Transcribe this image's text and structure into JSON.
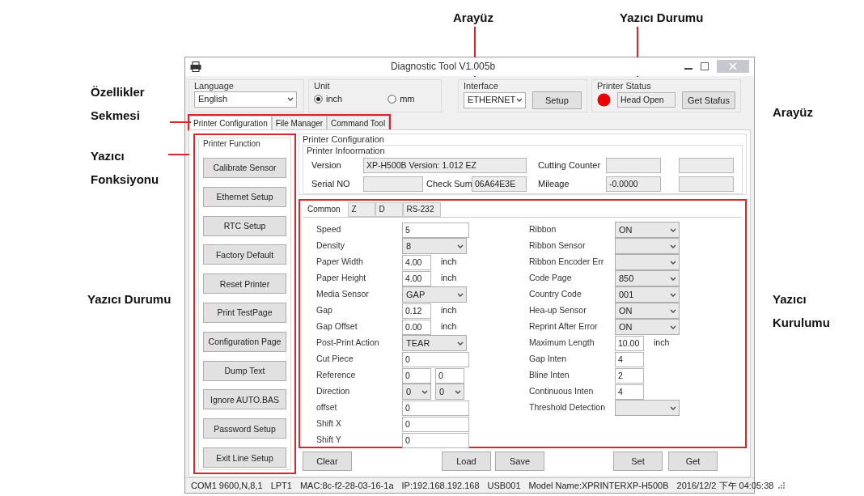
{
  "annotations": [
    {
      "text": "Arayüz",
      "kind": "top"
    },
    {
      "text": "Yazıcı Durumu",
      "kind": "top"
    },
    {
      "text": "Özellikler Sekmesi",
      "kind": "side"
    },
    {
      "text": "Yazıcı Fonksiyonu",
      "kind": "side"
    },
    {
      "text": "Yazıcı Durumu",
      "kind": "side"
    },
    {
      "text": "Arayüz",
      "kind": "side"
    },
    {
      "text": "Yazıcı Kurulumu",
      "kind": "side"
    }
  ],
  "window": {
    "title": "Diagnostic Tool V1.005b"
  },
  "language": {
    "label": "Language",
    "value": "English"
  },
  "unit": {
    "label": "Unit",
    "options": [
      {
        "label": "inch",
        "selected": true
      },
      {
        "label": "mm",
        "selected": false
      }
    ]
  },
  "interface": {
    "label": "Interface",
    "value": "ETHERNET",
    "button": "Setup"
  },
  "printer_status": {
    "label": "Printer Status",
    "color": "#ee0000",
    "value": "Head Open",
    "button": "Get Stafus"
  },
  "tabs": {
    "highlighted": true,
    "items": [
      {
        "label": "Printer Configuration",
        "selected": true
      },
      {
        "label": "File Manager",
        "selected": false
      },
      {
        "label": "Command Tool",
        "selected": false
      }
    ]
  },
  "printer_function": {
    "label": "Printer Function",
    "highlighted": true,
    "buttons": [
      "Calibrate Sensor",
      "Ethernet Setup",
      "RTC Setup",
      "Factory Default",
      "Reset Printer",
      "Print TestPage",
      "Configuration Page",
      "Dump Text",
      "Ignore AUTO.BAS",
      "Password Setup",
      "Exit Line Setup"
    ]
  },
  "printer_configuration": {
    "label": "Printer Configuration",
    "info_label": "Printer Infoormation",
    "rows": [
      [
        {
          "kind": "label",
          "text": "Version"
        },
        {
          "kind": "field",
          "value": "XP-H500B Version: 1.012 EZ"
        },
        "",
        "",
        {
          "kind": "label",
          "text": "Cutting Counter"
        },
        {
          "kind": "field"
        },
        {
          "kind": "field"
        }
      ],
      [
        {
          "kind": "label",
          "text": "Serial NO"
        },
        {
          "kind": "field"
        },
        {
          "kind": "label",
          "text": "Check Sum"
        },
        {
          "kind": "field",
          "value": "06A64E3E"
        },
        {
          "kind": "label",
          "text": "Mileage"
        },
        {
          "kind": "field",
          "value": "-0.0000"
        },
        {
          "kind": "field"
        }
      ]
    ]
  },
  "settings": {
    "highlighted": true,
    "tabs": [
      {
        "label": "Common",
        "selected": true
      },
      {
        "label": "Z",
        "selected": false
      },
      {
        "label": "D",
        "selected": false
      },
      {
        "label": "RS-232",
        "selected": false
      }
    ],
    "left_rows": [
      {
        "label": "Speed",
        "kind": "text",
        "value": "5"
      },
      {
        "label": "Density",
        "kind": "select",
        "value": "8"
      },
      {
        "label": "Paper Width",
        "kind": "text-unit",
        "value": "4.00",
        "unit": "inch"
      },
      {
        "label": "Paper Height",
        "kind": "text-unit",
        "value": "4.00",
        "unit": "inch"
      },
      {
        "label": "Media Sensor",
        "kind": "select",
        "value": "GAP"
      },
      {
        "label": "Gap",
        "kind": "text-unit",
        "value": "0.12",
        "unit": "inch"
      },
      {
        "label": "Gap Offset",
        "kind": "text-unit",
        "value": "0.00",
        "unit": "inch"
      },
      {
        "label": "Post-Print Action",
        "kind": "select",
        "value": "TEAR"
      },
      {
        "label": "Cut Piece",
        "kind": "text",
        "value": "0"
      },
      {
        "label": "Reference",
        "kind": "text-pair",
        "values": [
          "0",
          "0"
        ]
      },
      {
        "label": "Direction",
        "kind": "select-pair",
        "values": [
          "0",
          "0"
        ]
      },
      {
        "label": "offset",
        "kind": "text",
        "value": "0"
      },
      {
        "label": "Shift X",
        "kind": "text",
        "value": "0"
      },
      {
        "label": "Shift Y",
        "kind": "text",
        "value": "0"
      }
    ],
    "right_rows": [
      {
        "label": "Ribbon",
        "kind": "select",
        "value": "ON"
      },
      {
        "label": "Ribbon Sensor",
        "kind": "select"
      },
      {
        "label": "Ribbon Encoder Err",
        "kind": "select"
      },
      {
        "label": "Code Page",
        "kind": "select",
        "value": "850"
      },
      {
        "label": "Country Code",
        "kind": "select",
        "value": "001"
      },
      {
        "label": "Hea-up Sensor",
        "kind": "select",
        "value": "ON"
      },
      {
        "label": "Reprint After Error",
        "kind": "select",
        "value": "ON"
      },
      {
        "label": "Maximum Length",
        "kind": "text-unit",
        "value": "10.00",
        "unit": "inch"
      },
      {
        "label": "Gap Inten",
        "kind": "short",
        "value": "4"
      },
      {
        "label": "Bline Inten",
        "kind": "short",
        "value": "2"
      },
      {
        "label": "Continuous Inten",
        "kind": "short",
        "value": "4"
      },
      {
        "label": "Threshold Detection",
        "kind": "select"
      }
    ]
  },
  "bottom_buttons": [
    "Clear",
    "Load",
    "Save",
    "Set",
    "Get"
  ],
  "status_bar": [
    "COM1 9600,N,8,1",
    "LPT1",
    "MAC:8c-f2-28-03-16-1a",
    "IP:192.168.192.168",
    "USB001",
    "Model Name:XPRINTERXP-H500B",
    "2016/12/2 下午 04:05:38"
  ]
}
